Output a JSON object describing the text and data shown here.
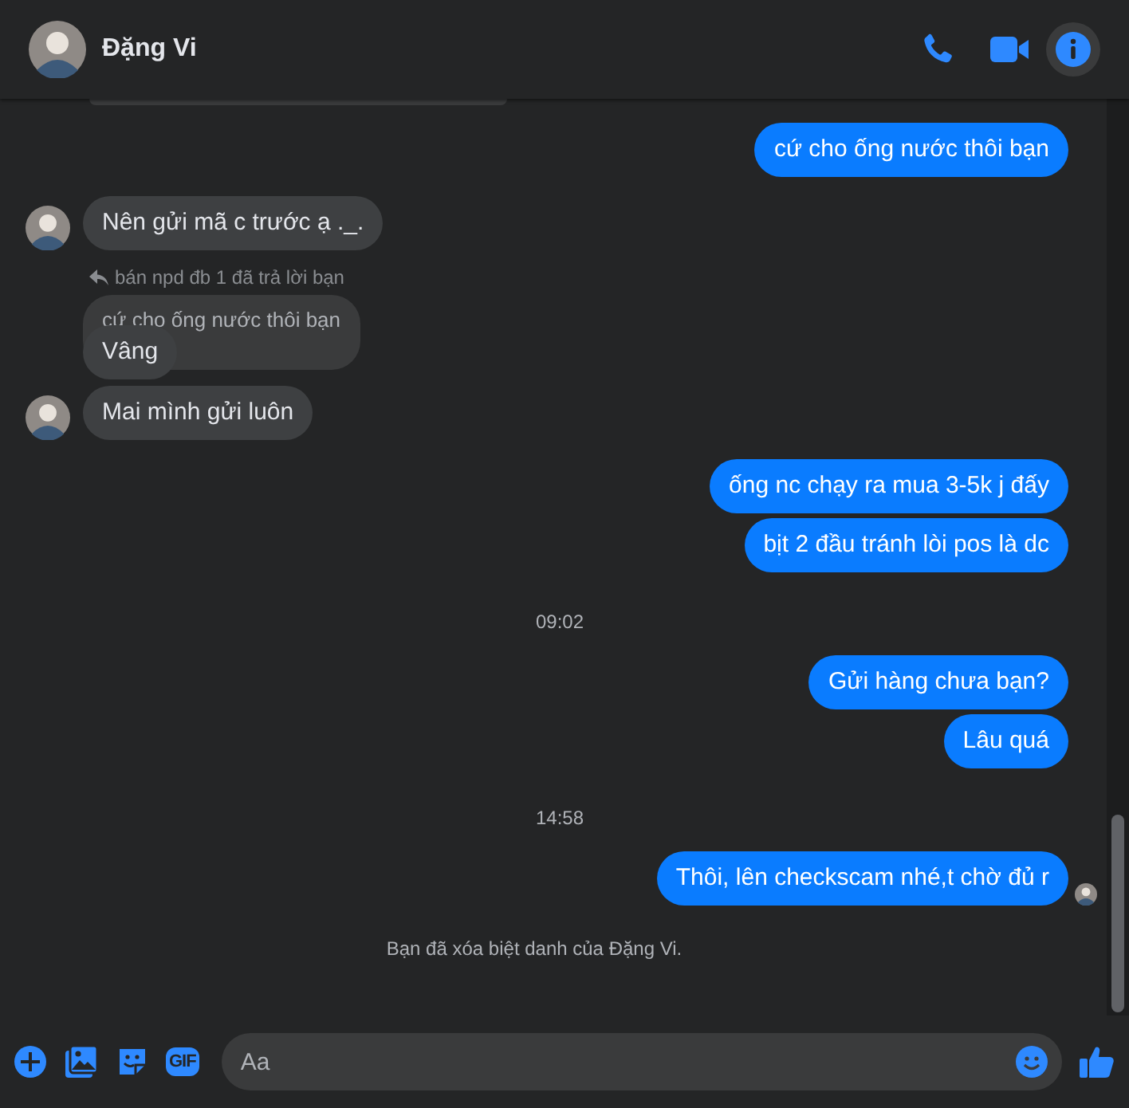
{
  "header": {
    "name": "Đặng Vi"
  },
  "messages": [
    {
      "kind": "outgoing",
      "text": "cứ cho ống nước thôi bạn",
      "seen": false
    },
    {
      "kind": "incoming",
      "text": "Nên gửi mã c trước ạ ._.",
      "avatar": true
    },
    {
      "kind": "reply_label",
      "text": "bán npd đb 1 đã trả lời bạn"
    },
    {
      "kind": "quoted",
      "text": "cứ cho ống nước thôi bạn"
    },
    {
      "kind": "incoming",
      "text": "Vâng",
      "avatar": false
    },
    {
      "kind": "incoming",
      "text": "Mai mình gửi luôn",
      "avatar": true
    },
    {
      "kind": "outgoing",
      "text": "ống nc chạy ra mua 3-5k j đấy",
      "seen": false
    },
    {
      "kind": "outgoing",
      "text": "bịt 2 đầu tránh lòi pos là dc",
      "seen": false
    },
    {
      "kind": "time",
      "text": "09:02"
    },
    {
      "kind": "outgoing",
      "text": "Gửi hàng chưa bạn?",
      "seen": false
    },
    {
      "kind": "outgoing",
      "text": "Lâu quá",
      "seen": false
    },
    {
      "kind": "time",
      "text": "14:58"
    },
    {
      "kind": "outgoing",
      "text": "Thôi, lên checkscam nhé,t chờ đủ r",
      "seen": true
    },
    {
      "kind": "notice",
      "text": "Bạn đã xóa biệt danh của Đặng Vi."
    }
  ],
  "composer": {
    "gif_label": "GIF",
    "placeholder": "Aa"
  }
}
